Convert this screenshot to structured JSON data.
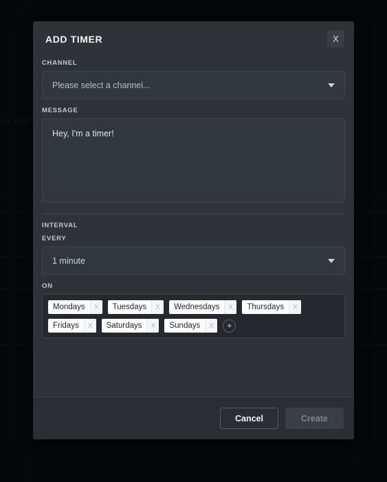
{
  "background": {
    "partial_text": "in a spec"
  },
  "modal": {
    "title": "ADD TIMER",
    "close_label": "X",
    "close_icon": "close-icon",
    "channel": {
      "label": "CHANNEL",
      "placeholder": "Please select a channel...",
      "value": "",
      "caret_icon": "chevron-down-icon"
    },
    "message": {
      "label": "MESSAGE",
      "value": "Hey, I'm a timer!",
      "placeholder": ""
    },
    "interval": {
      "label": "INTERVAL",
      "every_label": "EVERY",
      "every_value": "1 minute",
      "caret_icon": "chevron-down-icon",
      "on_label": "ON",
      "days": [
        {
          "label": "Mondays",
          "remove": "X"
        },
        {
          "label": "Tuesdays",
          "remove": "X"
        },
        {
          "label": "Wednesdays",
          "remove": "X"
        },
        {
          "label": "Thursdays",
          "remove": "X"
        },
        {
          "label": "Fridays",
          "remove": "X"
        },
        {
          "label": "Saturdays",
          "remove": "X"
        },
        {
          "label": "Sundays",
          "remove": "X"
        }
      ],
      "add_label": "+"
    },
    "footer": {
      "cancel_label": "Cancel",
      "create_label": "Create"
    }
  },
  "colors": {
    "modal_bg": "#2f3338",
    "field_bg": "#32373d",
    "tag_bg": "#ffffff",
    "tag_text": "#1d2125",
    "footer_bg": "#2b2f34",
    "page_bg": "#0c0d0f"
  }
}
